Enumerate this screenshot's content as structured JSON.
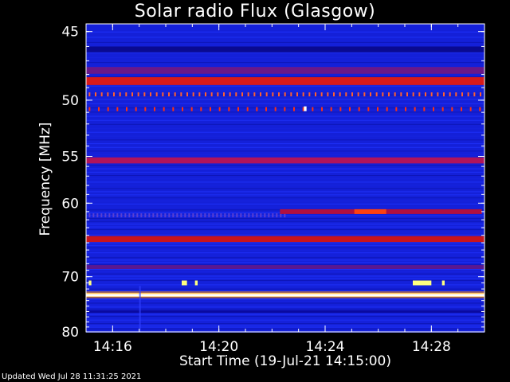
{
  "page": {
    "updated_text": "Updated Wed Jul 28 11:31:25 2021"
  },
  "chart_data": {
    "type": "heatmap",
    "title": "Solar radio Flux (Glasgow)",
    "xlabel": "Start Time (19-Jul-21 14:15:00)",
    "ylabel": "Frequency [MHz]",
    "x_ticks": [
      {
        "minute": 16,
        "label": "14:16"
      },
      {
        "minute": 20,
        "label": "14:20"
      },
      {
        "minute": 24,
        "label": "14:24"
      },
      {
        "minute": 28,
        "label": "14:28"
      }
    ],
    "y_ticks": [
      {
        "value": 45,
        "label": "45"
      },
      {
        "value": 50,
        "label": "50"
      },
      {
        "value": 55,
        "label": "55"
      },
      {
        "value": 60,
        "label": "60"
      },
      {
        "value": 70,
        "label": "70"
      },
      {
        "value": 80,
        "label": "80"
      }
    ],
    "xlim": [
      15,
      30
    ],
    "ylim": [
      80,
      44.5
    ],
    "y_scale": "reciprocal",
    "colormap": [
      "#05058c",
      "#1a28ff",
      "#8a1060",
      "#d41818",
      "#ff9a00",
      "#ffff70",
      "#ffffff"
    ],
    "background_color": "#1420d8",
    "continuous_bands": [
      {
        "freq": 46.2,
        "width": 0.4,
        "color": "#0a0a90"
      },
      {
        "freq": 47.7,
        "width": 0.5,
        "color": "#6a1888"
      },
      {
        "freq": 48.5,
        "width": 0.6,
        "color": "#d81a1a"
      },
      {
        "freq": 55.4,
        "width": 0.6,
        "color": "#b0145a"
      },
      {
        "freq": 64.5,
        "width": 0.8,
        "color": "#c8141c"
      },
      {
        "freq": 68.5,
        "width": 0.6,
        "color": "#5a1890"
      },
      {
        "freq": 73.0,
        "width": 0.7,
        "color": "#ffffc0"
      },
      {
        "freq": 76.0,
        "width": 0.5,
        "color": "#0a0aa0"
      }
    ],
    "dotted_bands": [
      {
        "freq": 49.5,
        "start": 15.1,
        "end": 29.9,
        "step": 0.23,
        "color": "#ff6030"
      },
      {
        "freq": 50.7,
        "start": 15.1,
        "end": 29.9,
        "step": 0.35,
        "color": "#ff3010"
      },
      {
        "freq": 61.4,
        "start": 15.1,
        "end": 22.5,
        "step": 0.15,
        "color": "#5a40d0"
      }
    ],
    "bursts": [
      {
        "freq": 61.0,
        "start": 22.3,
        "end": 29.9,
        "color": "#b01040"
      },
      {
        "freq": 61.0,
        "start": 25.1,
        "end": 26.3,
        "color": "#ff4010"
      },
      {
        "freq": 71.0,
        "start": 15.1,
        "end": 15.2,
        "color": "#ffff80"
      },
      {
        "freq": 71.0,
        "start": 18.6,
        "end": 18.8,
        "color": "#ffff80"
      },
      {
        "freq": 71.0,
        "start": 19.1,
        "end": 19.2,
        "color": "#ffff80"
      },
      {
        "freq": 71.0,
        "start": 27.3,
        "end": 28.0,
        "color": "#ffff80"
      },
      {
        "freq": 71.0,
        "start": 28.4,
        "end": 28.5,
        "color": "#ffff80"
      },
      {
        "freq": 50.7,
        "start": 23.2,
        "end": 23.3,
        "color": "#ffffff"
      }
    ]
  }
}
